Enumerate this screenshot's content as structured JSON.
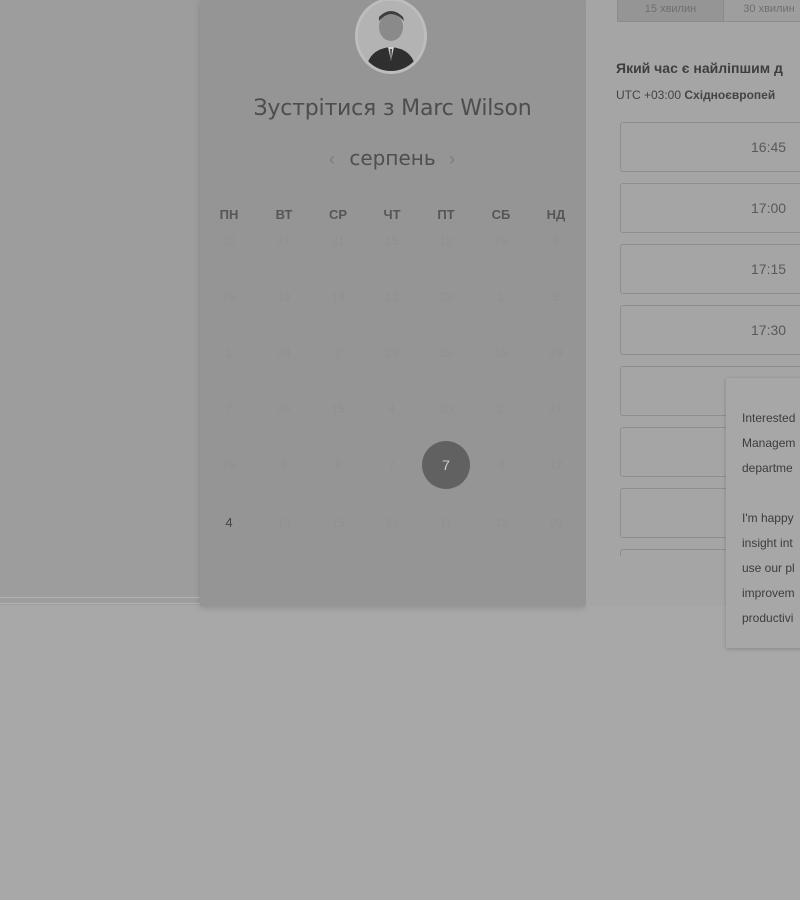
{
  "host": {
    "title": "Зустрітися з Marc Wilson",
    "avatar": "avatar-photo"
  },
  "calendar": {
    "month": "серпень",
    "prev_icon": "‹",
    "next_icon": "›",
    "weekdays": [
      "ПН",
      "ВТ",
      "СР",
      "ЧТ",
      "ПТ",
      "СБ",
      "НД"
    ],
    "weeks": [
      [
        "12",
        "21",
        "21",
        "15",
        "12",
        "29",
        "6"
      ],
      [
        "29",
        "18",
        "14",
        "12",
        "23",
        "1",
        "5"
      ],
      [
        "1",
        "24",
        "2",
        "23",
        "25",
        "18",
        "29"
      ],
      [
        "7",
        "20",
        "15",
        "4",
        "20",
        "2",
        "21"
      ],
      [
        "28",
        "3",
        "8",
        "7",
        "7",
        "4",
        "12"
      ],
      [
        "4",
        "10",
        "15",
        "21",
        "11",
        "12",
        "20"
      ]
    ],
    "selected_day": "7",
    "available_day": "4"
  },
  "durations": {
    "active": "15 хвилин",
    "other": "30 хвилин"
  },
  "scheduler": {
    "question": "Який час є найліпшим д",
    "timezone_offset": "UTC +03:00",
    "timezone_name": "Східноєвропей",
    "slots": [
      "16:45",
      "17:00",
      "17:15",
      "17:30",
      "",
      "",
      "",
      ""
    ]
  },
  "info_popup": {
    "text": "Interested\nManagem\ndepartme\n\nI'm happy\ninsight int\nuse our pl\nimprovem\nproductivi"
  },
  "colors": {
    "overlay_bg": "#a8a8a8",
    "selected_day": "#616161"
  }
}
